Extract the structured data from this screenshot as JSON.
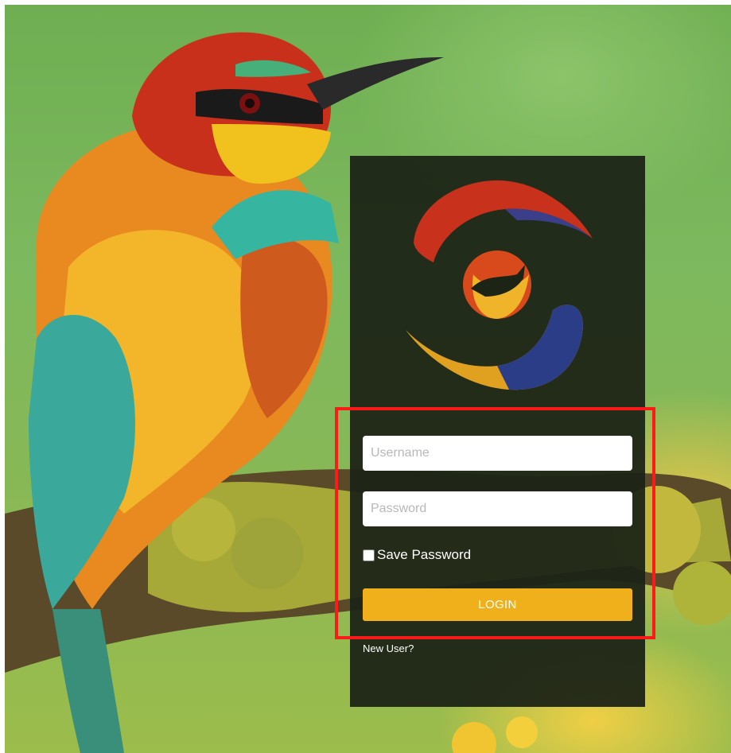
{
  "login_form": {
    "username_placeholder": "Username",
    "password_placeholder": "Password",
    "save_password_label": "Save Password",
    "login_button_label": "LOGIN",
    "new_user_link": "New User?"
  },
  "colors": {
    "panel": "#1c2416",
    "login_button": "#efb01c",
    "highlight_border": "#ff1a1a"
  }
}
